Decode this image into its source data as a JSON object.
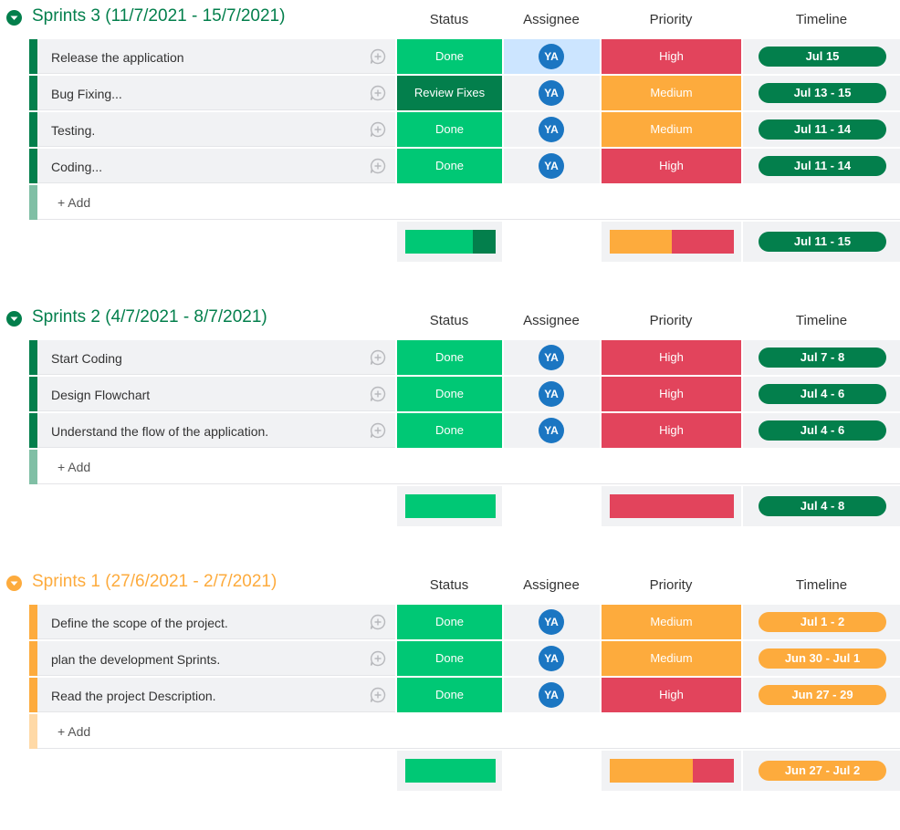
{
  "colors": {
    "green_group": "#037f4c",
    "orange_group": "#fdab3d",
    "done": "#00c875",
    "review": "#037f4c",
    "high": "#e2445c",
    "medium": "#fdab3d",
    "assignee_highlight": "#cce5ff"
  },
  "columns": {
    "status": "Status",
    "assignee": "Assignee",
    "priority": "Priority",
    "timeline": "Timeline"
  },
  "add_label": "+ Add",
  "groups": [
    {
      "title": "Sprints 3 (11/7/2021 - 15/7/2021)",
      "color": "green",
      "icon": "chevron-down-icon",
      "rows": [
        {
          "name": "Release the application",
          "status": "Done",
          "assignee": "YA",
          "priority": "High",
          "timeline": "Jul 15"
        },
        {
          "name": "Bug Fixing...",
          "status": "Review Fixes",
          "assignee": "YA",
          "priority": "Medium",
          "timeline": "Jul 13 - 15"
        },
        {
          "name": "Testing.",
          "status": "Done",
          "assignee": "YA",
          "priority": "Medium",
          "timeline": "Jul 11 - 14"
        },
        {
          "name": "Coding...",
          "status": "Done",
          "assignee": "YA",
          "priority": "High",
          "timeline": "Jul 11 - 14"
        }
      ],
      "summary": {
        "status_dist": [
          {
            "status": "Done",
            "fraction": 0.75
          },
          {
            "status": "Review Fixes",
            "fraction": 0.25
          }
        ],
        "priority_dist": [
          {
            "priority": "Medium",
            "fraction": 0.5
          },
          {
            "priority": "High",
            "fraction": 0.5
          }
        ],
        "timeline": "Jul 11 - 15"
      }
    },
    {
      "title": "Sprints 2 (4/7/2021 - 8/7/2021)",
      "color": "green",
      "icon": "chevron-down-icon",
      "rows": [
        {
          "name": "Start Coding",
          "status": "Done",
          "assignee": "YA",
          "priority": "High",
          "timeline": "Jul 7 - 8"
        },
        {
          "name": "Design Flowchart",
          "status": "Done",
          "assignee": "YA",
          "priority": "High",
          "timeline": "Jul 4 - 6"
        },
        {
          "name": "Understand the flow of the application.",
          "status": "Done",
          "assignee": "YA",
          "priority": "High",
          "timeline": "Jul 4 - 6"
        }
      ],
      "summary": {
        "status_dist": [
          {
            "status": "Done",
            "fraction": 1.0
          }
        ],
        "priority_dist": [
          {
            "priority": "High",
            "fraction": 1.0
          }
        ],
        "timeline": "Jul 4 - 8"
      }
    },
    {
      "title": "Sprints 1 (27/6/2021 - 2/7/2021)",
      "color": "orange",
      "icon": "chevron-down-icon",
      "rows": [
        {
          "name": "Define the scope of the project.",
          "status": "Done",
          "assignee": "YA",
          "priority": "Medium",
          "timeline": "Jul 1 - 2"
        },
        {
          "name": "plan the development Sprints.",
          "status": "Done",
          "assignee": "YA",
          "priority": "Medium",
          "timeline": "Jun 30 - Jul 1"
        },
        {
          "name": "Read the project Description.",
          "status": "Done",
          "assignee": "YA",
          "priority": "High",
          "timeline": "Jun 27 - 29"
        }
      ],
      "summary": {
        "status_dist": [
          {
            "status": "Done",
            "fraction": 1.0
          }
        ],
        "priority_dist": [
          {
            "priority": "Medium",
            "fraction": 0.67
          },
          {
            "priority": "High",
            "fraction": 0.33
          }
        ],
        "timeline": "Jun 27 - Jul 2"
      }
    }
  ]
}
